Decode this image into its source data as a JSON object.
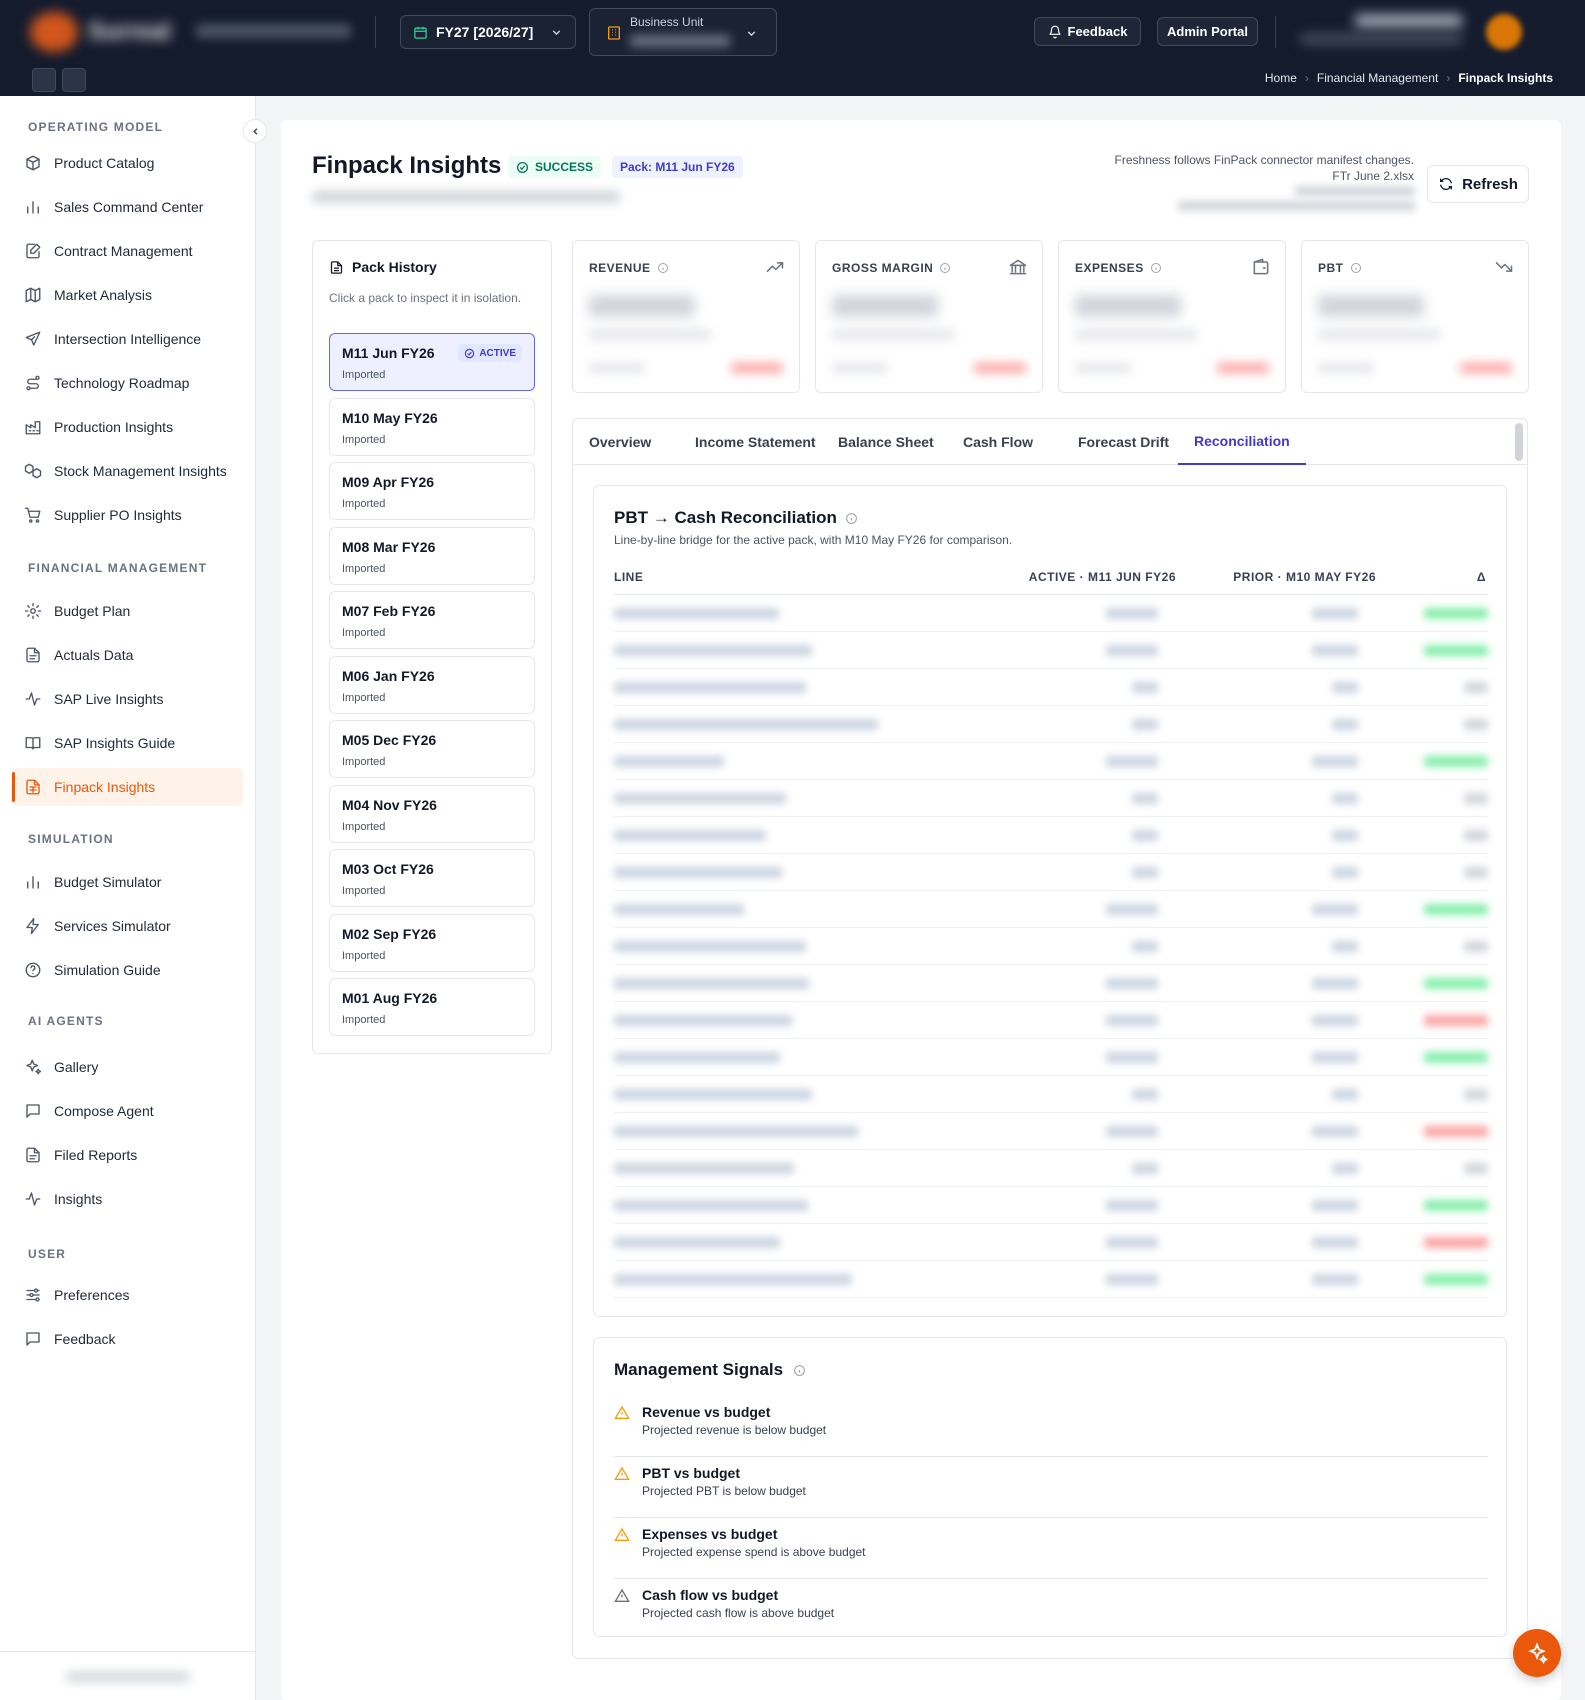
{
  "topbar": {
    "brand": "Surreal",
    "fiscal_year": "FY27 [2026/27]",
    "business_unit_label": "Business Unit",
    "feedback_label": "Feedback",
    "admin_label": "Admin Portal",
    "breadcrumbs": [
      "Home",
      "Financial Management",
      "Finpack Insights"
    ]
  },
  "sidebar": {
    "sections": [
      {
        "title": "OPERATING MODEL",
        "items": [
          {
            "label": "Product Catalog",
            "icon": "box-icon"
          },
          {
            "label": "Sales Command Center",
            "icon": "bar-chart-icon"
          },
          {
            "label": "Contract Management",
            "icon": "edit-document-icon"
          },
          {
            "label": "Market Analysis",
            "icon": "map-icon"
          },
          {
            "label": "Intersection Intelligence",
            "icon": "send-icon"
          },
          {
            "label": "Technology Roadmap",
            "icon": "route-icon"
          },
          {
            "label": "Production Insights",
            "icon": "factory-icon"
          },
          {
            "label": "Stock Management Insights",
            "icon": "boxes-icon"
          },
          {
            "label": "Supplier PO Insights",
            "icon": "cart-icon"
          }
        ]
      },
      {
        "title": "FINANCIAL MANAGEMENT",
        "items": [
          {
            "label": "Budget Plan",
            "icon": "gear-icon"
          },
          {
            "label": "Actuals Data",
            "icon": "file-icon"
          },
          {
            "label": "SAP Live Insights",
            "icon": "pulse-icon"
          },
          {
            "label": "SAP Insights Guide",
            "icon": "book-icon"
          },
          {
            "label": "Finpack Insights",
            "icon": "spreadsheet-icon"
          }
        ]
      },
      {
        "title": "SIMULATION",
        "items": [
          {
            "label": "Budget Simulator",
            "icon": "bar-chart-icon"
          },
          {
            "label": "Services Simulator",
            "icon": "lightning-icon"
          },
          {
            "label": "Simulation Guide",
            "icon": "help-circle-icon"
          }
        ]
      },
      {
        "title": "AI AGENTS",
        "items": [
          {
            "label": "Gallery",
            "icon": "sparkles-icon"
          },
          {
            "label": "Compose Agent",
            "icon": "message-icon"
          },
          {
            "label": "Filed Reports",
            "icon": "file-icon"
          },
          {
            "label": "Insights",
            "icon": "pulse-icon"
          }
        ]
      },
      {
        "title": "USER",
        "items": [
          {
            "label": "Preferences",
            "icon": "sliders-icon"
          },
          {
            "label": "Feedback",
            "icon": "message-icon"
          }
        ]
      }
    ],
    "active": "Finpack Insights"
  },
  "page": {
    "title": "Finpack Insights",
    "status": "SUCCESS",
    "pack_badge": "Pack: M11 Jun FY26",
    "freshness_line1": "Freshness follows FinPack connector manifest changes.",
    "freshness_line2": "FTr June 2.xlsx",
    "refresh_label": "Refresh"
  },
  "pack_history": {
    "title": "Pack History",
    "description": "Click a pack to inspect it in isolation.",
    "active_label": "ACTIVE",
    "packs": [
      {
        "name": "M11 Jun FY26",
        "status": "Imported"
      },
      {
        "name": "M10 May FY26",
        "status": "Imported"
      },
      {
        "name": "M09 Apr FY26",
        "status": "Imported"
      },
      {
        "name": "M08 Mar FY26",
        "status": "Imported"
      },
      {
        "name": "M07 Feb FY26",
        "status": "Imported"
      },
      {
        "name": "M06 Jan FY26",
        "status": "Imported"
      },
      {
        "name": "M05 Dec FY26",
        "status": "Imported"
      },
      {
        "name": "M04 Nov FY26",
        "status": "Imported"
      },
      {
        "name": "M03 Oct FY26",
        "status": "Imported"
      },
      {
        "name": "M02 Sep FY26",
        "status": "Imported"
      },
      {
        "name": "M01 Aug FY26",
        "status": "Imported"
      }
    ]
  },
  "kpis": [
    {
      "label": "REVENUE",
      "icon": "trend-up-icon"
    },
    {
      "label": "GROSS MARGIN",
      "icon": "bank-icon"
    },
    {
      "label": "EXPENSES",
      "icon": "wallet-icon"
    },
    {
      "label": "PBT",
      "icon": "trend-down-icon"
    }
  ],
  "tabs": [
    "Overview",
    "Income Statement",
    "Balance Sheet",
    "Cash Flow",
    "Forecast Drift",
    "Reconciliation"
  ],
  "active_tab": "Reconciliation",
  "reconciliation": {
    "title": "PBT → Cash Reconciliation",
    "subtitle": "Line-by-line bridge for the active pack, with M10 May FY26 for comparison.",
    "columns": [
      "LINE",
      "ACTIVE · M11 JUN FY26",
      "PRIOR · M10 MAY FY26",
      "Δ"
    ]
  },
  "signals": {
    "title": "Management Signals",
    "items": [
      {
        "title": "Revenue vs budget",
        "desc": "Projected revenue is below budget",
        "color": "#f59e0b"
      },
      {
        "title": "PBT vs budget",
        "desc": "Projected PBT is below budget",
        "color": "#f59e0b"
      },
      {
        "title": "Expenses vs budget",
        "desc": "Projected expense spend is above budget",
        "color": "#f59e0b"
      },
      {
        "title": "Cash flow vs budget",
        "desc": "Projected cash flow is above budget",
        "color": "#6b7280"
      }
    ]
  },
  "colors": {
    "accent": "#ea580c",
    "nav_bg": "#141b2d",
    "link": "#4338ca"
  }
}
